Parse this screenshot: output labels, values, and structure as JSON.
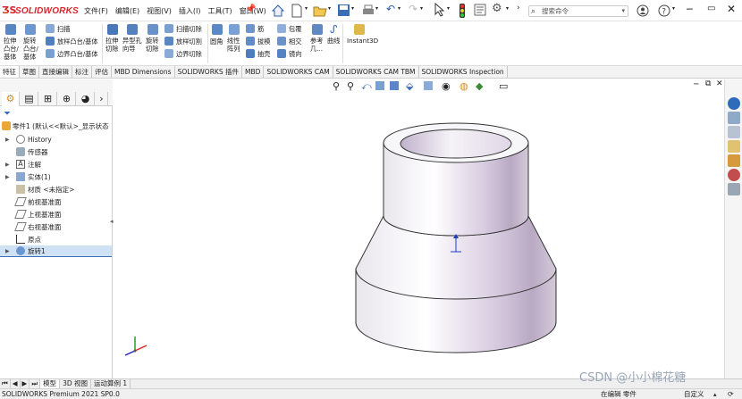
{
  "app": {
    "logo_text": "SOLIDWORKS"
  },
  "menu": [
    "文件(F)",
    "编辑(E)",
    "视图(V)",
    "插入(I)",
    "工具(T)",
    "窗口(W)"
  ],
  "search": {
    "placeholder": "搜索命令"
  },
  "ribbon": {
    "extrude_boss": "拉伸\n凸台/\n基体",
    "revolve_boss": "旋转\n凸台/\n基体",
    "sweep": "扫描",
    "loft_boss": "放样凸台/基体",
    "boundary_boss": "边界凸台/基体",
    "extrude_cut": "拉伸\n切除",
    "hole_wizard": "异型孔\n向导",
    "revolve_cut": "旋转\n切除",
    "sweep_cut": "扫描切除",
    "loft_cut": "放样切割",
    "boundary_cut": "边界切除",
    "fillet": "圆角",
    "linear_pattern": "线性\n阵列",
    "rib": "筋",
    "draft": "拔模",
    "shell": "抽壳",
    "wrap": "包覆",
    "intersect": "相交",
    "mirror": "镜向",
    "ref_geometry": "参考\n几...",
    "curves": "曲线",
    "instant3d": "Instant3D"
  },
  "tabs": [
    "特征",
    "草图",
    "直接编辑",
    "标注",
    "评估",
    "MBD Dimensions",
    "SOLIDWORKS 插件",
    "MBD",
    "SOLIDWORKS CAM",
    "SOLIDWORKS CAM TBM",
    "SOLIDWORKS Inspection"
  ],
  "tree": {
    "root": "零件1 (默认<<默认>_显示状态",
    "items": [
      "History",
      "传感器",
      "注解",
      "实体(1)",
      "材质 <未指定>",
      "前视基准面",
      "上视基准面",
      "右视基准面",
      "原点",
      "旋转1"
    ]
  },
  "bottom_tabs": [
    "模型",
    "3D 视图",
    "运动算例 1"
  ],
  "status": {
    "left": "SOLIDWORKS Premium 2021 SP0.0",
    "editing": "在编辑 零件",
    "custom": "自定义"
  },
  "watermark": "CSDN @小小棉花糖",
  "colors": {
    "brand": "#d8262b",
    "model_shade": "#b9a9c3",
    "origin_blue": "#1e3cc8"
  }
}
